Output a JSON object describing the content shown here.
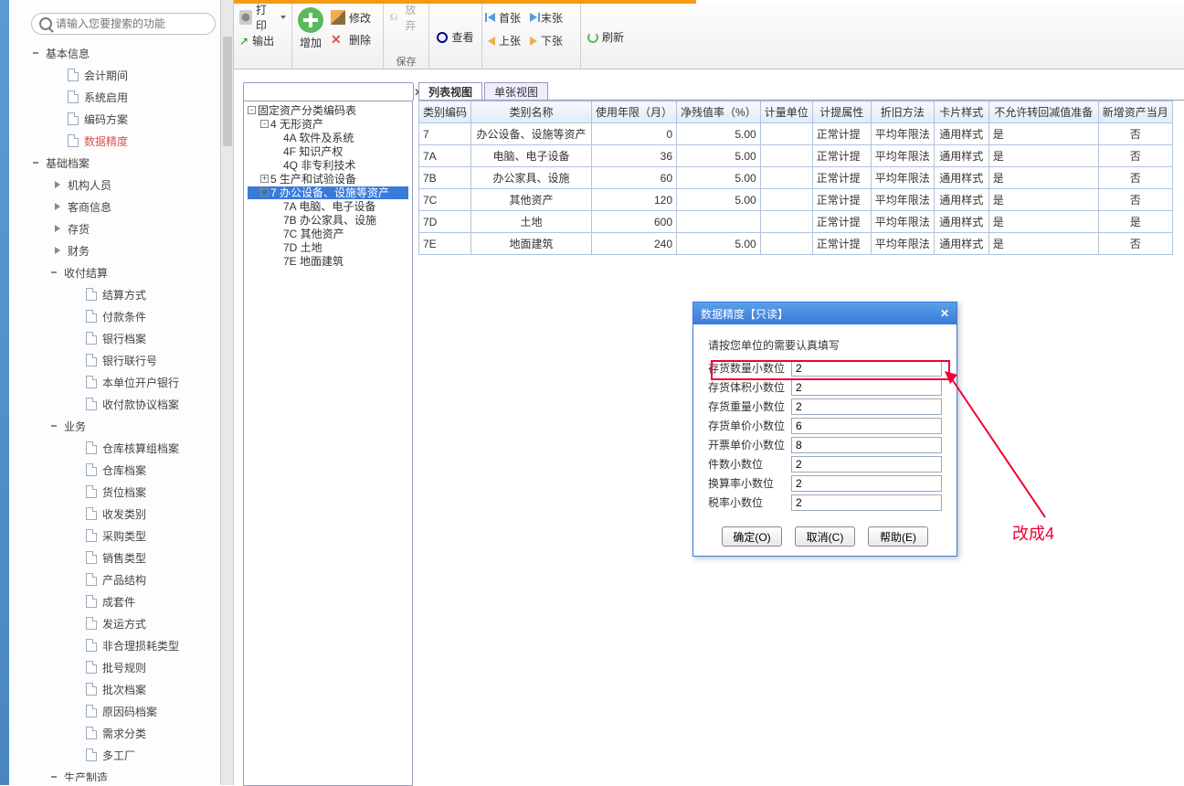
{
  "search": {
    "placeholder": "请输入您要搜索的功能"
  },
  "nav": {
    "basicInfo": {
      "label": "基本信息",
      "items": [
        "会计期间",
        "系统启用",
        "编码方案",
        "数据精度"
      ],
      "selectedIndex": 3
    },
    "basicFile": {
      "label": "基础档案",
      "subs": {
        "org": "机构人员",
        "cust": "客商信息",
        "stock": "存货",
        "fin": "财务",
        "pay": {
          "label": "收付结算",
          "items": [
            "结算方式",
            "付款条件",
            "银行档案",
            "银行联行号",
            "本单位开户银行",
            "收付款协议档案"
          ]
        },
        "biz": {
          "label": "业务",
          "items": [
            "仓库核算组档案",
            "仓库档案",
            "货位档案",
            "收发类别",
            "采购类型",
            "销售类型",
            "产品结构",
            "成套件",
            "发运方式",
            "非合理损耗类型",
            "批号规则",
            "批次档案",
            "原因码档案",
            "需求分类",
            "多工厂"
          ]
        },
        "prod": "生产制造"
      }
    }
  },
  "toolbar": {
    "print": "打印",
    "export": "输出",
    "add": "增加",
    "modify": "修改",
    "discard": "放弃",
    "delete": "删除",
    "save": "保存",
    "view": "查看",
    "first": "首张",
    "last": "末张",
    "prev": "上张",
    "next": "下张",
    "refresh": "刷新"
  },
  "tree": {
    "root": "固定资产分类编码表",
    "n4": {
      "code": "4",
      "label": "无形资产",
      "children": [
        {
          "code": "4A",
          "label": "软件及系统"
        },
        {
          "code": "4F",
          "label": "知识产权"
        },
        {
          "code": "4Q",
          "label": "非专利技术"
        }
      ]
    },
    "n5": {
      "code": "5",
      "label": "生产和试验设备"
    },
    "n7": {
      "code": "7",
      "label": "办公设备、设施等资产",
      "children": [
        {
          "code": "7A",
          "label": "电脑、电子设备"
        },
        {
          "code": "7B",
          "label": "办公家具、设施"
        },
        {
          "code": "7C",
          "label": "其他资产"
        },
        {
          "code": "7D",
          "label": "土地"
        },
        {
          "code": "7E",
          "label": "地面建筑"
        }
      ]
    },
    "selected": "7"
  },
  "tabs": [
    "列表视图",
    "单张视图"
  ],
  "grid": {
    "headers": [
      "类别编码",
      "类别名称",
      "使用年限（月）",
      "净残值率（%）",
      "计量单位",
      "计提属性",
      "折旧方法",
      "卡片样式",
      "不允许转回减值准备",
      "新增资产当月"
    ],
    "rows": [
      {
        "code": "7",
        "name": "办公设备、设施等资产",
        "months": "0",
        "rate": "5.00",
        "unit": "",
        "attr": "正常计提",
        "dep": "平均年限法",
        "card": "通用样式",
        "dis": "是",
        "new": "否"
      },
      {
        "code": "7A",
        "name": "电脑、电子设备",
        "months": "36",
        "rate": "5.00",
        "unit": "",
        "attr": "正常计提",
        "dep": "平均年限法",
        "card": "通用样式",
        "dis": "是",
        "new": "否"
      },
      {
        "code": "7B",
        "name": "办公家具、设施",
        "months": "60",
        "rate": "5.00",
        "unit": "",
        "attr": "正常计提",
        "dep": "平均年限法",
        "card": "通用样式",
        "dis": "是",
        "new": "否"
      },
      {
        "code": "7C",
        "name": "其他资产",
        "months": "120",
        "rate": "5.00",
        "unit": "",
        "attr": "正常计提",
        "dep": "平均年限法",
        "card": "通用样式",
        "dis": "是",
        "new": "否"
      },
      {
        "code": "7D",
        "name": "土地",
        "months": "600",
        "rate": "",
        "unit": "",
        "attr": "正常计提",
        "dep": "平均年限法",
        "card": "通用样式",
        "dis": "是",
        "new": "是"
      },
      {
        "code": "7E",
        "name": "地面建筑",
        "months": "240",
        "rate": "5.00",
        "unit": "",
        "attr": "正常计提",
        "dep": "平均年限法",
        "card": "通用样式",
        "dis": "是",
        "new": "否"
      }
    ]
  },
  "dialog": {
    "title": "数据精度【只读】",
    "hint": "请按您单位的需要认真填写",
    "fields": [
      {
        "label": "存货数量小数位",
        "value": "2"
      },
      {
        "label": "存货体积小数位",
        "value": "2"
      },
      {
        "label": "存货重量小数位",
        "value": "2"
      },
      {
        "label": "存货单价小数位",
        "value": "6"
      },
      {
        "label": "开票单价小数位",
        "value": "8"
      },
      {
        "label": "件数小数位",
        "value": "2"
      },
      {
        "label": "换算率小数位",
        "value": "2"
      },
      {
        "label": "税率小数位",
        "value": "2"
      }
    ],
    "buttons": {
      "ok": "确定(O)",
      "cancel": "取消(C)",
      "help": "帮助(E)"
    }
  },
  "annotation": {
    "text": "改成4"
  }
}
